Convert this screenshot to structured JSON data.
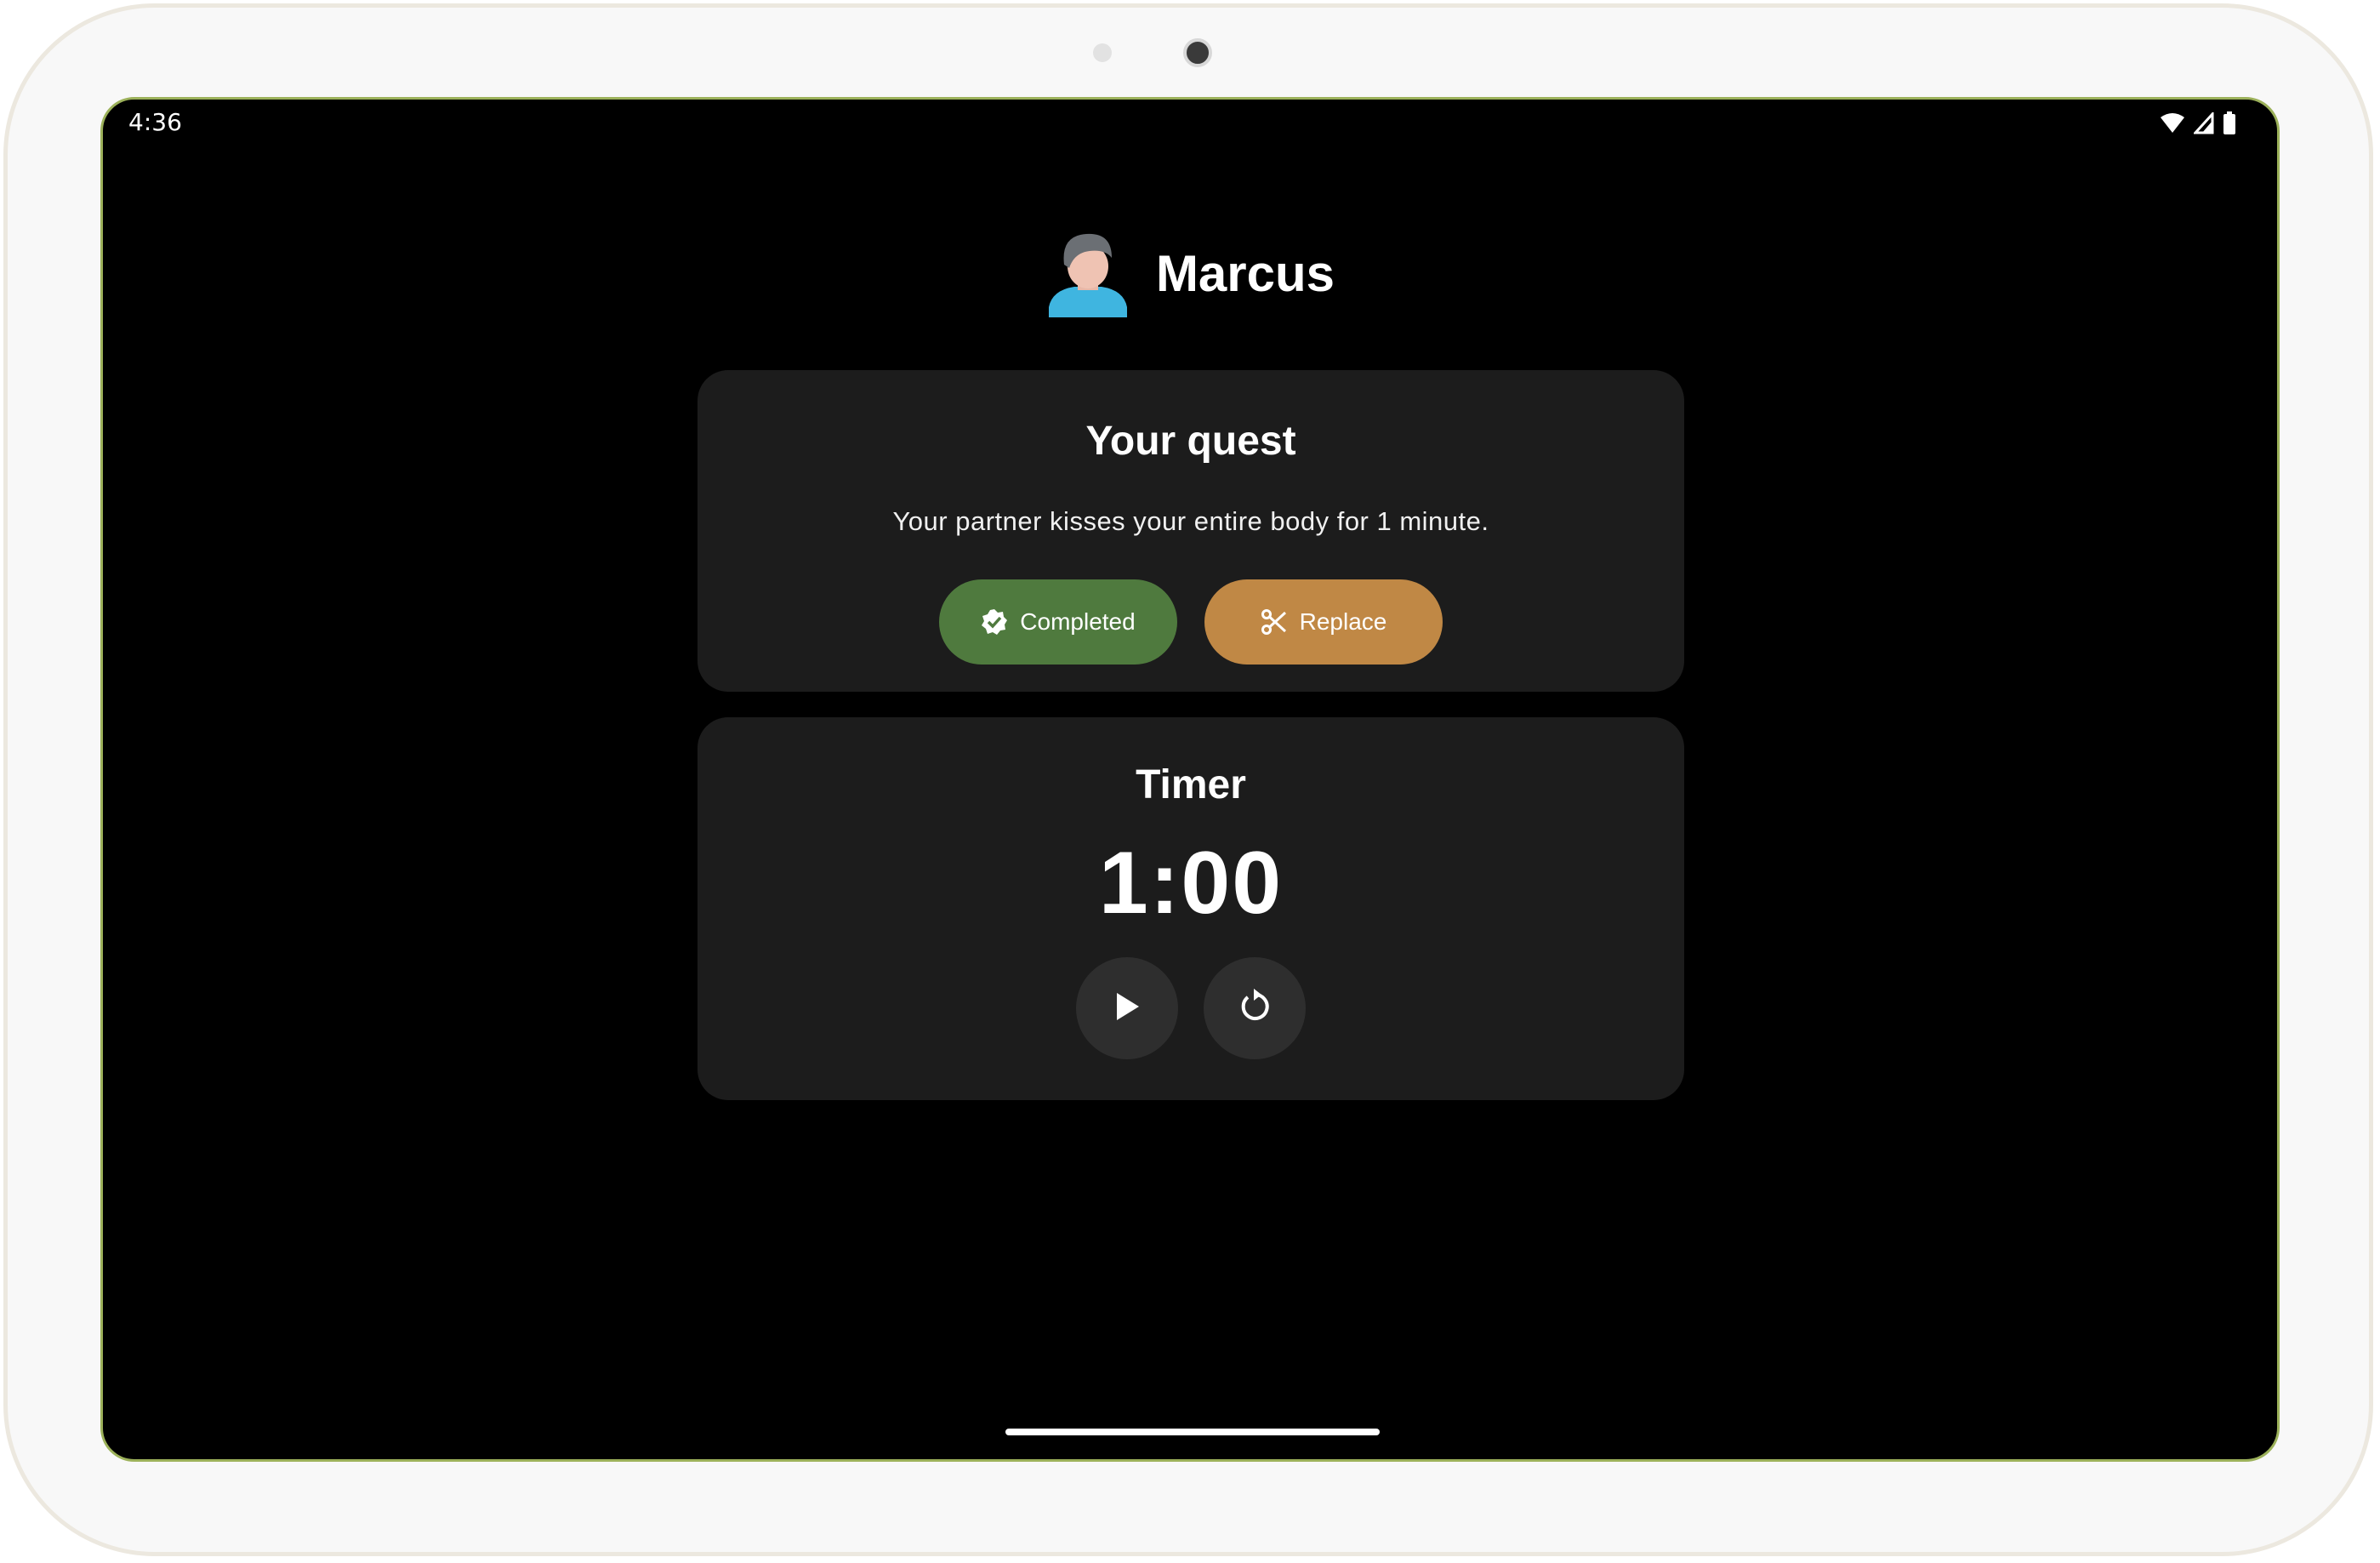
{
  "status_bar": {
    "time": "4:36",
    "icons": [
      "wifi-icon",
      "signal-icon",
      "battery-icon"
    ]
  },
  "profile": {
    "name": "Marcus",
    "avatar_icon": "user-avatar-icon"
  },
  "quest": {
    "title": "Your quest",
    "description": "Your partner kisses your entire body for 1 minute.",
    "completed_label": "Completed",
    "completed_icon": "verified-check-icon",
    "replace_label": "Replace",
    "replace_icon": "scissors-icon"
  },
  "timer": {
    "title": "Timer",
    "value": "1:00",
    "play_icon": "play-icon",
    "reset_icon": "restart-icon"
  },
  "colors": {
    "background": "#000000",
    "card": "#1c1c1c",
    "completed": "#4f7a3e",
    "replace": "#c08845",
    "round_button": "#2e2e2e"
  }
}
